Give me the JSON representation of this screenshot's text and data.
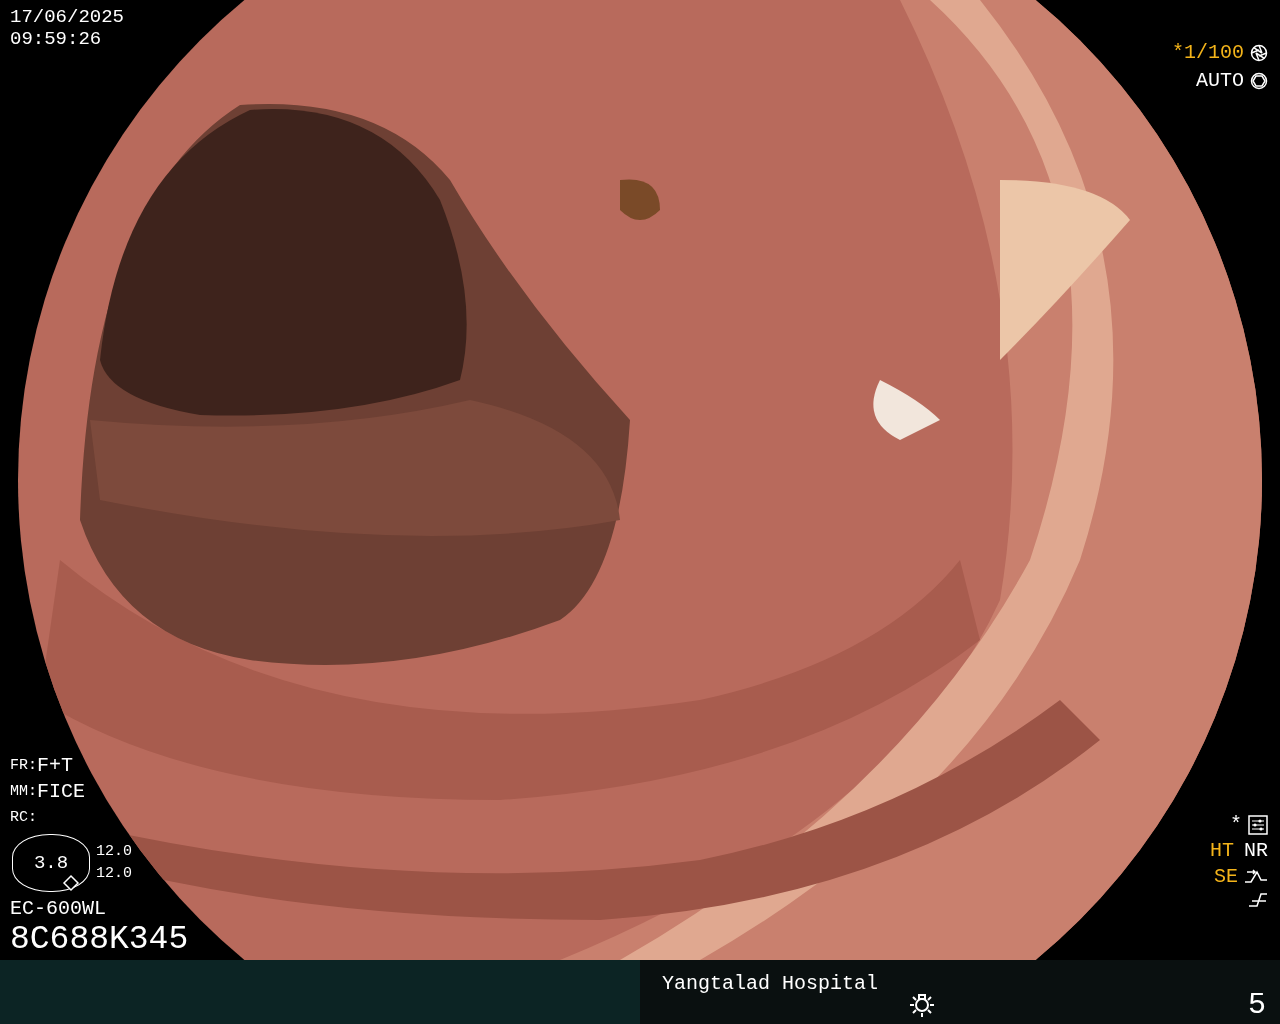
{
  "datetime": {
    "date": "17/06/2025",
    "time": "09:59:26"
  },
  "exposure": [
    {
      "kind": "shutter",
      "text": "*1/100",
      "active": true
    },
    {
      "kind": "iris",
      "text": "AUTO",
      "active": false
    }
  ],
  "settings": [
    {
      "label": "FR:",
      "value": "F+T"
    },
    {
      "label": "MM:",
      "value": "FICE"
    },
    {
      "label": "RC:"
    }
  ],
  "zoom": {
    "value": "3.8",
    "readings": [
      "12.0",
      "12.0"
    ]
  },
  "scope": {
    "model": "EC-600WL",
    "serial": "8C688K345"
  },
  "preset": {
    "mark": "*"
  },
  "processing": [
    {
      "text": "HT",
      "active": true
    },
    {
      "text": "NR",
      "active": false
    }
  ],
  "enhancement": {
    "text": "SE",
    "active": true
  },
  "footer": {
    "hospital": "Yangtalad Hospital",
    "page": "5"
  }
}
